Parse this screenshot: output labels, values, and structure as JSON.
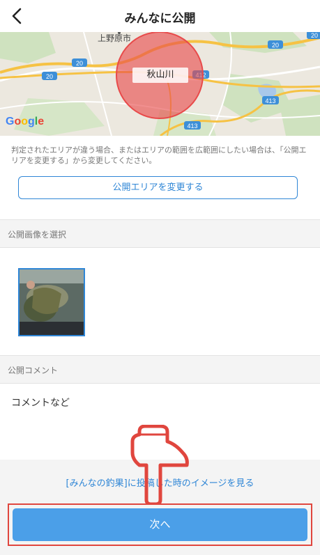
{
  "header": {
    "title": "みんなに公開",
    "back_icon": "chevron-left-icon"
  },
  "map": {
    "place_top": "上野原市",
    "center_label": "秋山川",
    "route_labels": [
      "20",
      "20",
      "20",
      "20",
      "412",
      "413",
      "413"
    ],
    "brand": [
      "G",
      "o",
      "o",
      "g",
      "l",
      "e"
    ]
  },
  "area": {
    "note": "判定されたエリアが違う場合、またはエリアの範囲を広範囲にしたい場合は、「公開エリアを変更する」から変更してください。",
    "change_button": "公開エリアを変更する"
  },
  "image_section": {
    "heading": "公開画像を選択"
  },
  "comment_section": {
    "heading": "公開コメント",
    "value": "コメントなど"
  },
  "footer": {
    "preview_link": "[みんなの釣果]に投稿した時のイメージを見る",
    "next_button": "次へ"
  },
  "colors": {
    "accent": "#2f86d6",
    "next_button": "#4b9fe8",
    "highlight": "#e0463e",
    "area_circle": "#e84a4a"
  }
}
